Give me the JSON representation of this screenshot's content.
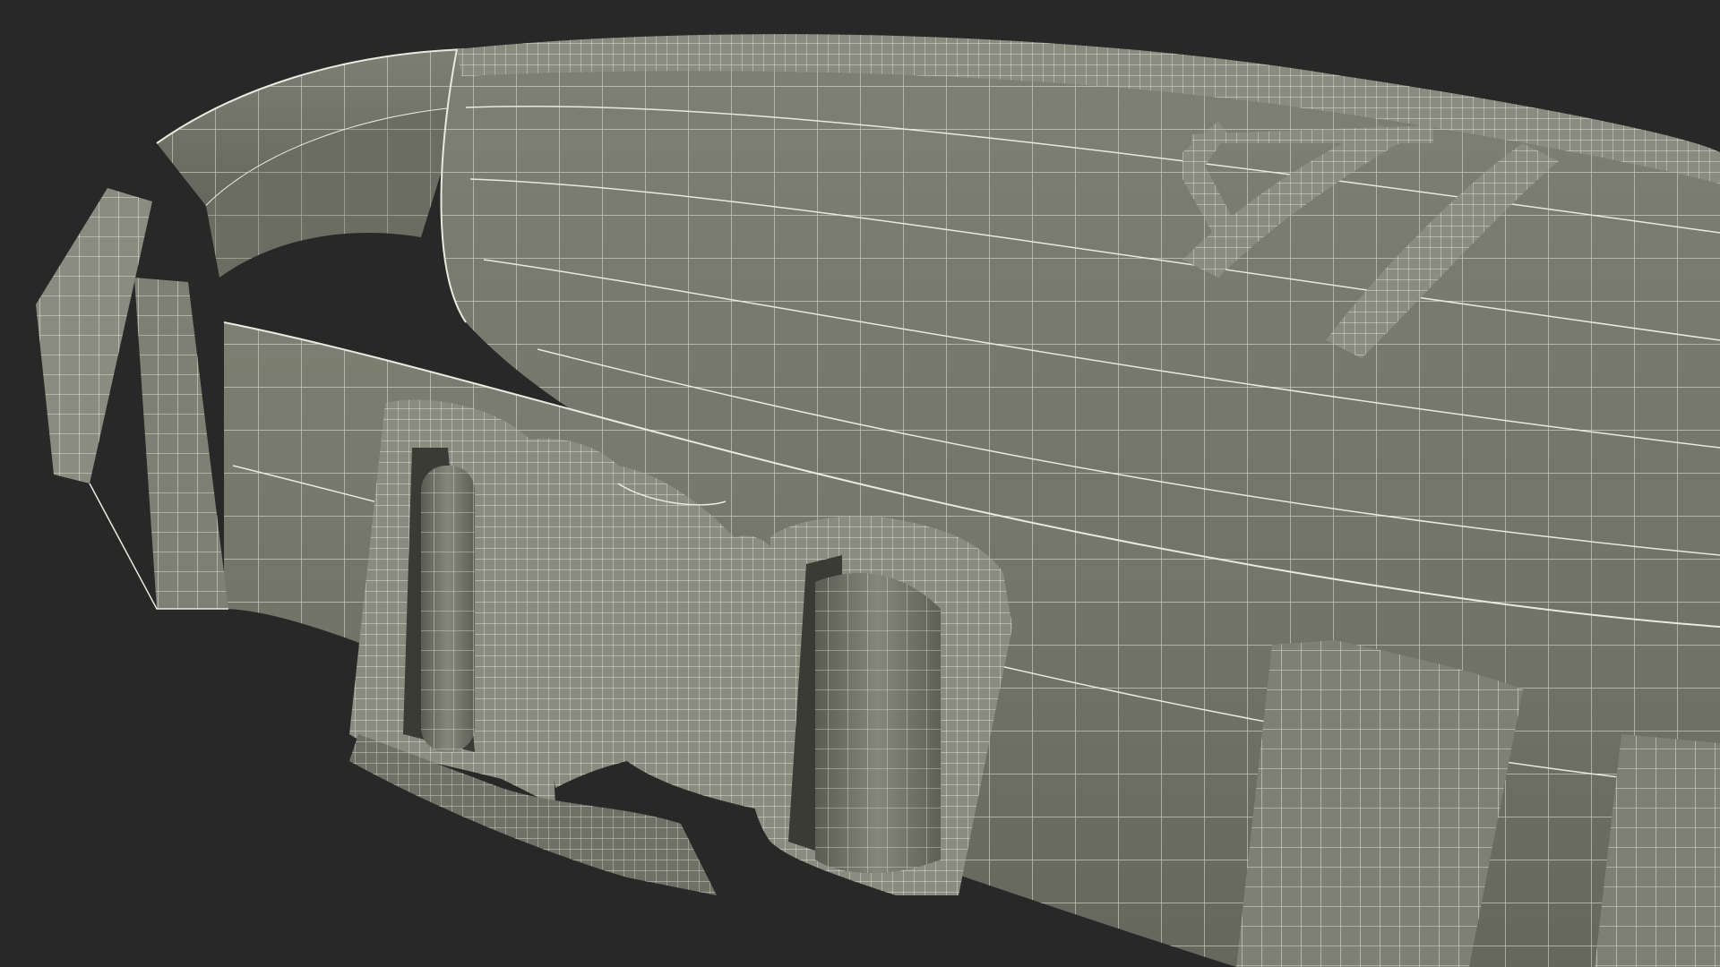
{
  "scene": {
    "subject": "waist-bag-wireframe-render",
    "colors": {
      "background": "#282828",
      "surface": "#7b7d70",
      "surface_dark": "#6a6c60",
      "surface_shadow": "#55574d",
      "wire": "#e9eadf"
    }
  }
}
